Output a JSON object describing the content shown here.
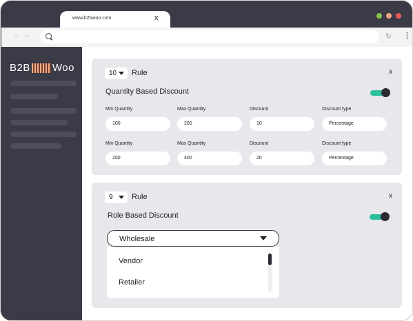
{
  "browser": {
    "tab_title": "www.b2bwoo.com",
    "tab_close": "x",
    "nav_arrows": "←→",
    "reload_glyph": "↻",
    "menu_glyph": "⋮",
    "window_dots": [
      "#8bc34a",
      "#f4a582",
      "#e85a5a"
    ]
  },
  "sidebar": {
    "logo_left": "B2B",
    "logo_right": "Woo"
  },
  "rule1": {
    "number": "10",
    "label": "Rule",
    "close": "x",
    "title": "Quantity Based Discount",
    "enabled": true,
    "headers": [
      "Min Quantity",
      "Max Quantity",
      "Discount",
      "Discount type"
    ],
    "rows": [
      [
        "100",
        "200",
        "10",
        "Percentage"
      ],
      [
        "200",
        "400",
        "20",
        "Percentage"
      ]
    ]
  },
  "rule2": {
    "number": "9",
    "label": "Rule",
    "close": "x",
    "title": "Role Based Discount",
    "enabled": true,
    "selected_role": "Wholesale",
    "options": [
      "Vendor",
      "Retailer"
    ]
  }
}
